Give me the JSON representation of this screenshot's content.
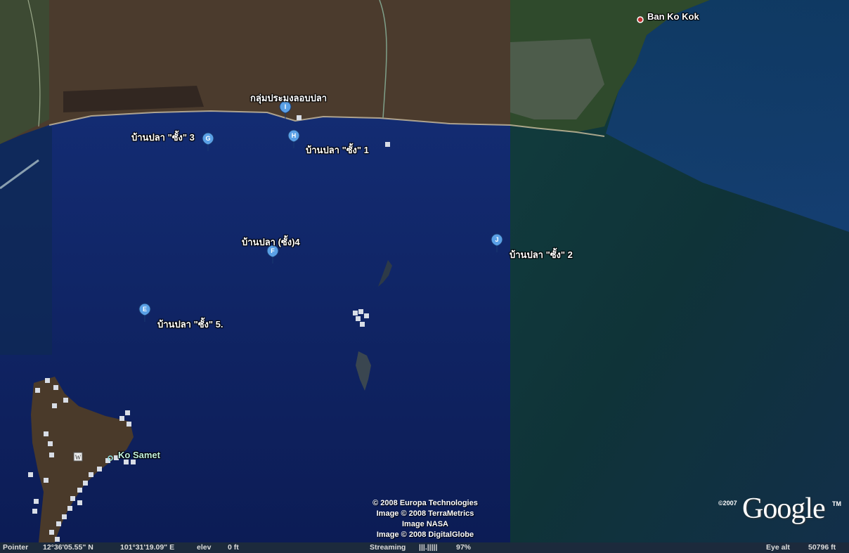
{
  "map": {
    "places": {
      "ban_ko_kok": "Ban Ko Kok",
      "ko_samet": "Ko Samet"
    },
    "markers": [
      {
        "id": "I",
        "label": "กลุ่มประมงลอบปลา"
      },
      {
        "id": "H",
        "label": "บ้านปลา \"ซั้ง\" 1"
      },
      {
        "id": "G",
        "label": "บ้านปลา \"ซั้ง\" 3"
      },
      {
        "id": "J",
        "label": "บ้านปลา \"ซั้ง\" 2"
      },
      {
        "id": "F",
        "label": "บ้านปลา (ซั้ง)4"
      },
      {
        "id": "E",
        "label": "บ้านปลา \"ซั้ง\" 5."
      }
    ],
    "attribution": [
      "© 2008 Europa Technologies",
      "Image © 2008 TerraMetrics",
      "Image NASA",
      "Image © 2008 DigitalGlobe"
    ],
    "logo": {
      "text": "Google",
      "copyright": "©2007",
      "tm": "TM"
    },
    "colors": {
      "sea": "#0d1f5c",
      "sea_east": "#143a3a",
      "land": "#4a3a2c",
      "pin": "#5aa0e6"
    }
  },
  "statusbar": {
    "pointer_label": "Pointer",
    "lat": "12°36'05.55\" N",
    "lon": "101°31'19.09\" E",
    "elev_label": "elev",
    "elev_value": "0 ft",
    "streaming_label": "Streaming",
    "streaming_bar": "|||.|||||",
    "streaming_pct": "97%",
    "eye_alt_label": "Eye alt",
    "eye_alt_value": "50796 ft"
  }
}
